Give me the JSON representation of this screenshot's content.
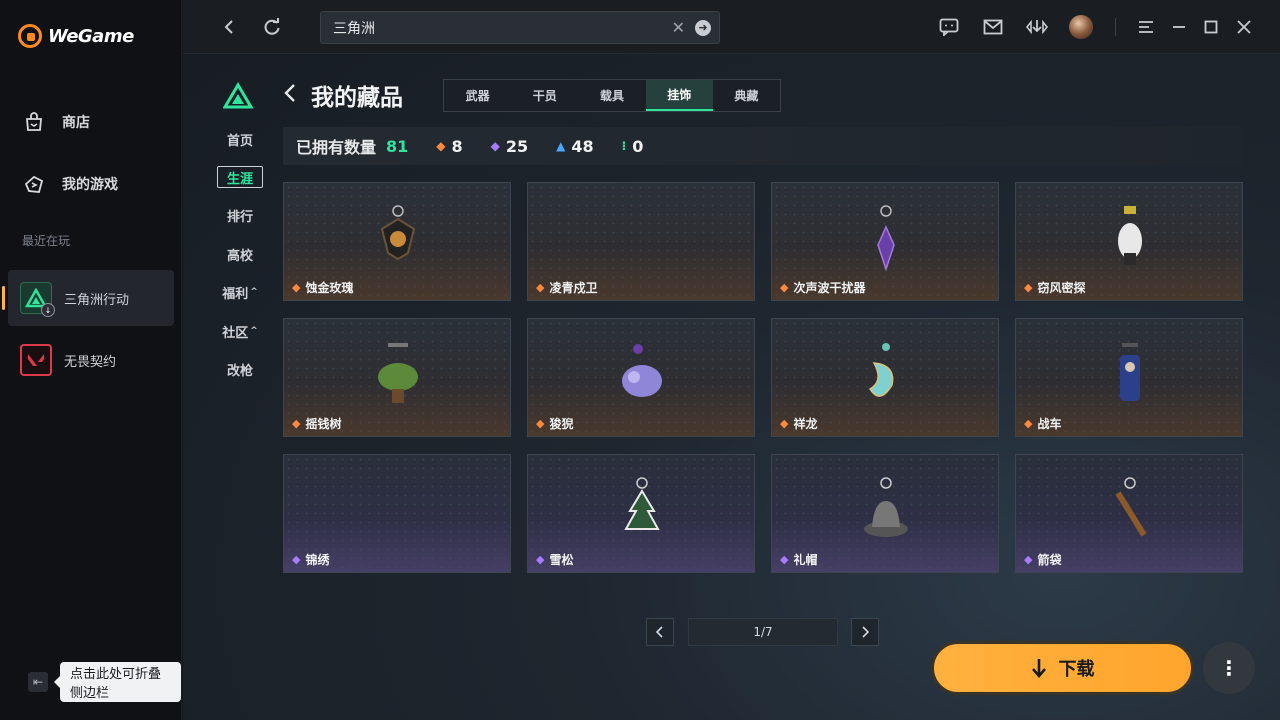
{
  "app": {
    "name": "WeGame"
  },
  "sidebar": {
    "items": [
      {
        "label": "商店",
        "icon": "store-icon"
      },
      {
        "label": "我的游戏",
        "icon": "gamepad-icon"
      }
    ],
    "recent_label": "最近在玩",
    "recent_games": [
      {
        "label": "三角洲行动",
        "active": true
      },
      {
        "label": "无畏契约",
        "active": false
      }
    ],
    "collapse_tip": "点击此处可折叠侧边栏"
  },
  "topbar": {
    "search_value": "三角洲",
    "icons": [
      "back-icon",
      "refresh-icon",
      "chat-icon",
      "mail-icon",
      "download-manager-icon",
      "menu-icon",
      "minimize-icon",
      "maximize-icon",
      "close-icon"
    ]
  },
  "game_nav": {
    "items": [
      {
        "label": "首页"
      },
      {
        "label": "生涯",
        "active": true
      },
      {
        "label": "排行"
      },
      {
        "label": "高校"
      },
      {
        "label": "福利",
        "caret": "^"
      },
      {
        "label": "社区",
        "caret": "^"
      },
      {
        "label": "改枪"
      }
    ]
  },
  "collection": {
    "title": "我的藏品",
    "tabs": [
      {
        "label": "武器"
      },
      {
        "label": "干员"
      },
      {
        "label": "载具"
      },
      {
        "label": "挂饰",
        "active": true
      },
      {
        "label": "典藏"
      }
    ],
    "stats": {
      "owned_label": "已拥有数量",
      "owned_total": "81",
      "counts": [
        {
          "value": "8",
          "color": "#ff8a3d",
          "glyph": "◆"
        },
        {
          "value": "25",
          "color": "#a87cff",
          "glyph": "◆"
        },
        {
          "value": "48",
          "color": "#4aa6ff",
          "glyph": "▲"
        },
        {
          "value": "0",
          "color": "#2ee59d",
          "glyph": "⁝"
        }
      ]
    },
    "items": [
      {
        "name": "蚀金玫瑰",
        "rarity": "orange"
      },
      {
        "name": "凌青戍卫",
        "rarity": "orange"
      },
      {
        "name": "次声波干扰器",
        "rarity": "orange"
      },
      {
        "name": "窃风密探",
        "rarity": "orange"
      },
      {
        "name": "摇钱树",
        "rarity": "orange"
      },
      {
        "name": "狻猊",
        "rarity": "orange"
      },
      {
        "name": "祥龙",
        "rarity": "orange"
      },
      {
        "name": "战车",
        "rarity": "orange"
      },
      {
        "name": "锦绣",
        "rarity": "purple"
      },
      {
        "name": "雪松",
        "rarity": "purple"
      },
      {
        "name": "礼帽",
        "rarity": "purple"
      },
      {
        "name": "箭袋",
        "rarity": "purple"
      }
    ],
    "pager": {
      "text": "1/7"
    }
  },
  "download_button": {
    "label": "下载"
  }
}
